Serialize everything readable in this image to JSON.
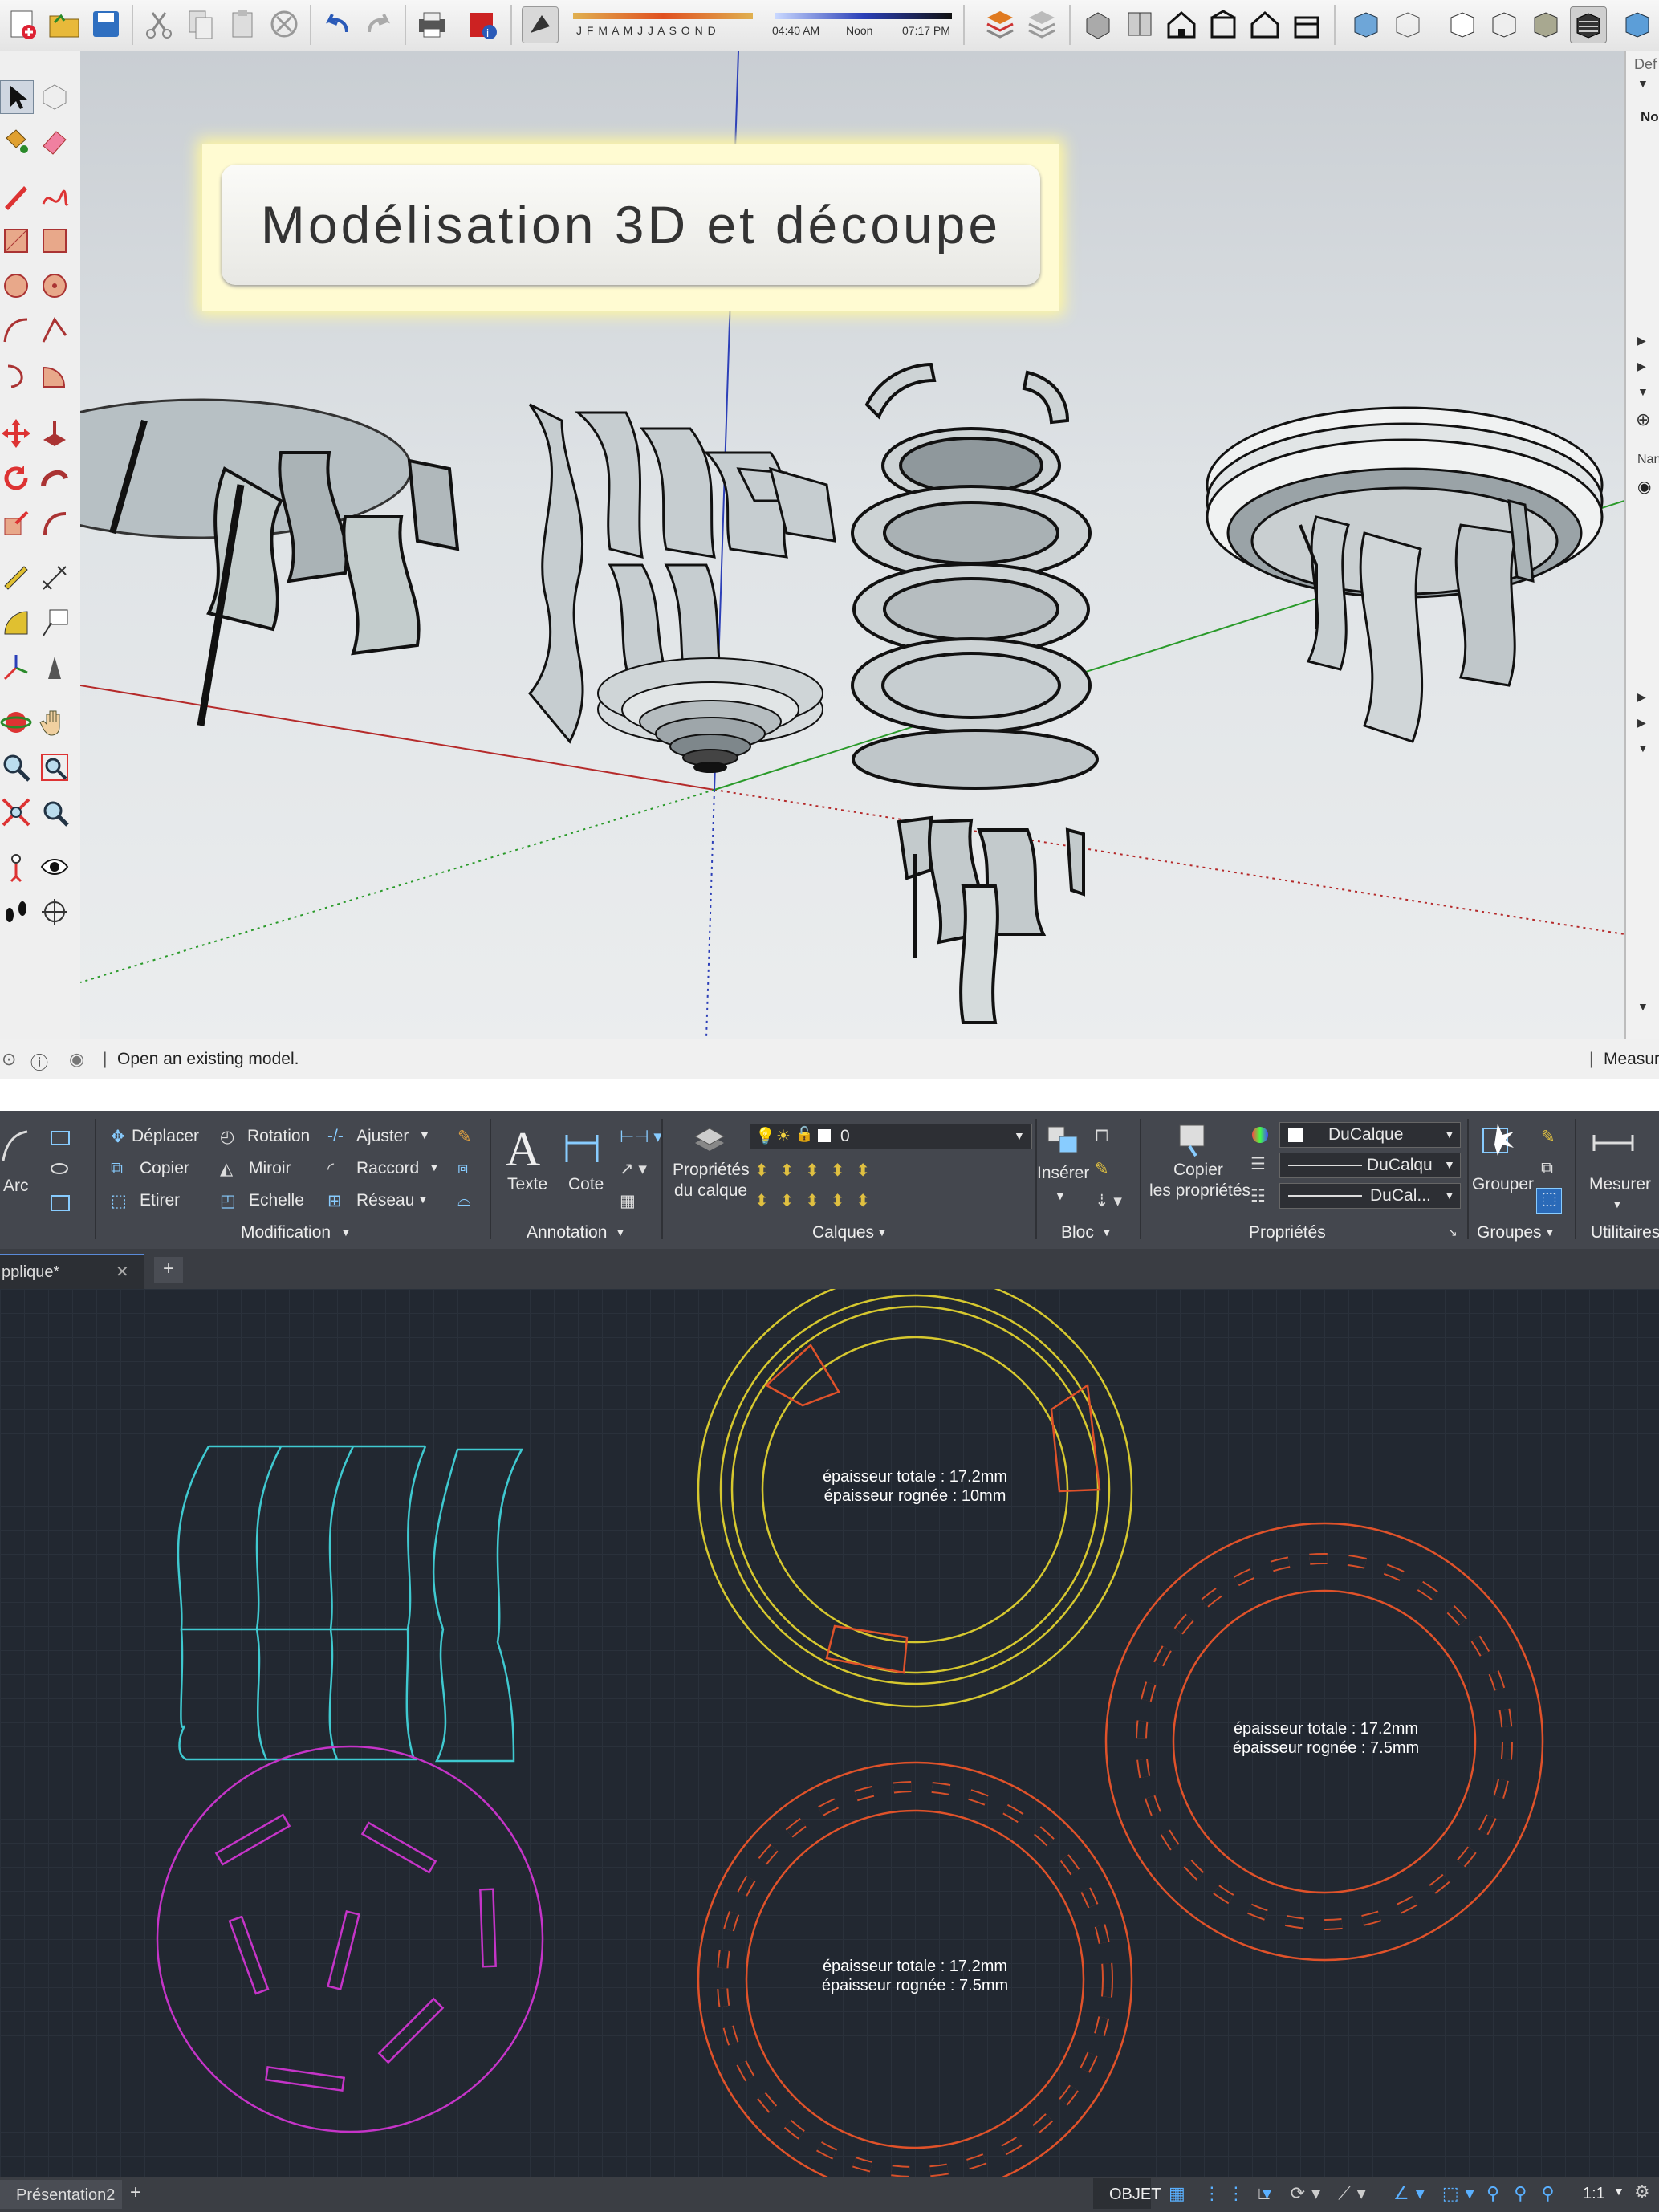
{
  "sketchup": {
    "toolbar": {
      "months": "J F M A M J J A S O N D",
      "time_start": "04:40 AM",
      "time_noon": "Noon",
      "time_end": "07:17 PM"
    },
    "title_card": "Modélisation 3D et découpe",
    "status_text": "Open an existing model.",
    "status_right": "Measur",
    "right_panel": {
      "top_label": "Def",
      "label_no": "No",
      "label_nam": "Nan"
    },
    "colors": {
      "x_axis": "#c03030",
      "y_axis": "#2a9a2a",
      "z_axis": "#2c3fb8"
    }
  },
  "autocad": {
    "ribbon": {
      "draw": {
        "arc": "Arc"
      },
      "modification": {
        "label": "Modification",
        "deplacer": "Déplacer",
        "rotation": "Rotation",
        "ajuster": "Ajuster",
        "copier": "Copier",
        "miroir": "Miroir",
        "raccord": "Raccord",
        "etirer": "Etirer",
        "echelle": "Echelle",
        "reseau": "Réseau"
      },
      "annotation": {
        "label": "Annotation",
        "texte": "Texte",
        "cote": "Cote"
      },
      "calques": {
        "label": "Calques",
        "proprietes_line1": "Propriétés",
        "proprietes_line2": "du calque",
        "layer_value": "0"
      },
      "bloc": {
        "label": "Bloc",
        "inserer": "Insérer"
      },
      "proprietes": {
        "label": "Propriétés",
        "copier_line1": "Copier",
        "copier_line2": "les propriétés",
        "color": "DuCalque",
        "linetype": "DuCalqu",
        "lineweight": "DuCal..."
      },
      "groupes": {
        "label": "Groupes",
        "grouper": "Grouper"
      },
      "utilitaires": {
        "label": "Utilitaires",
        "mesurer": "Mesurer"
      }
    },
    "doc_tab": "pplique*",
    "layout_tab": "Présentation2",
    "status": {
      "objet": "OBJET",
      "scale": "1:1"
    },
    "drawing": {
      "ring_yellow": {
        "line1": "épaisseur totale : 17.2mm",
        "line2": "épaisseur rognée : 10mm"
      },
      "ring_right": {
        "line1": "épaisseur totale : 17.2mm",
        "line2": "épaisseur rognée : 7.5mm"
      },
      "ring_bottom": {
        "line1": "épaisseur totale : 17.2mm",
        "line2": "épaisseur rognée : 7.5mm"
      }
    },
    "colors": {
      "cyan": "#3fc9d0",
      "yellow": "#d6c82f",
      "orange": "#e0522a",
      "magenta": "#c534c8"
    }
  }
}
